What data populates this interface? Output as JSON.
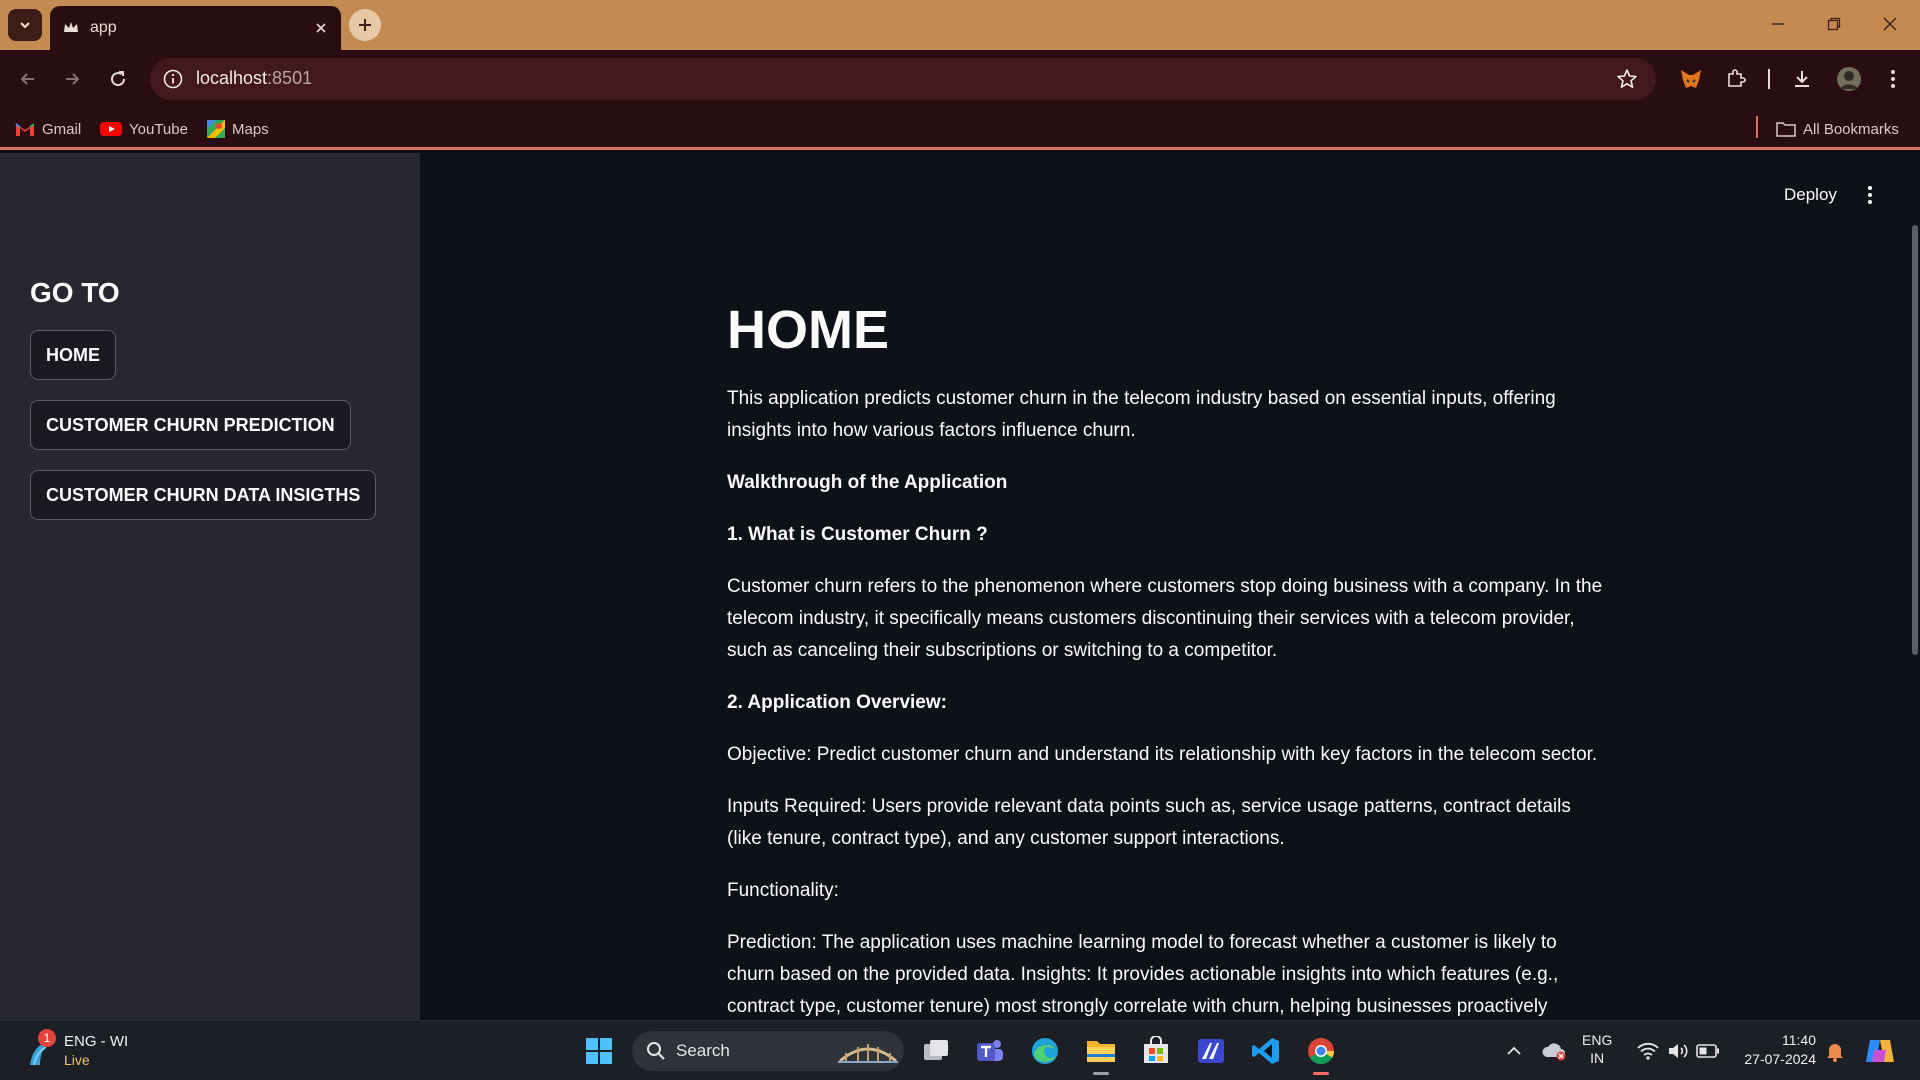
{
  "browser": {
    "tab_title": "app",
    "url_host": "localhost",
    "url_port": ":8501",
    "bookmarks": [
      {
        "label": "Gmail",
        "icon": "gmail-icon"
      },
      {
        "label": "YouTube",
        "icon": "youtube-icon"
      },
      {
        "label": "Maps",
        "icon": "maps-icon"
      }
    ],
    "all_bookmarks_label": "All Bookmarks"
  },
  "sidebar": {
    "heading": "GO TO",
    "buttons": [
      {
        "label": "HOME"
      },
      {
        "label": "CUSTOMER CHURN PREDICTION"
      },
      {
        "label": "CUSTOMER CHURN DATA INSIGTHS"
      }
    ]
  },
  "header": {
    "deploy_label": "Deploy"
  },
  "main": {
    "title": "HOME",
    "intro": "This application predicts customer churn in the telecom industry based on essential inputs, offering insights into how various factors influence churn.",
    "walkthrough_heading": "Walkthrough of the Application",
    "section1_heading": "1. What is Customer Churn ?",
    "section1_text": "Customer churn refers to the phenomenon where customers stop doing business with a company. In the telecom industry, it specifically means customers discontinuing their services with a telecom provider, such as canceling their subscriptions or switching to a competitor.",
    "section2_heading": "2. Application Overview:",
    "objective": "Objective: Predict customer churn and understand its relationship with key factors in the telecom sector.",
    "inputs": "Inputs Required: Users provide relevant data points such as, service usage patterns, contract details (like tenure, contract type), and any customer support interactions.",
    "functionality": "Functionality:",
    "prediction": "Prediction: The application uses machine learning model to forecast whether a customer is likely to churn based on the provided data. Insights: It provides actionable insights into which features (e.g., contract type, customer tenure) most strongly correlate with churn, helping businesses proactively manage"
  },
  "taskbar": {
    "weather_badge": "1",
    "weather_line1": "ENG - WI",
    "weather_line2": "Live",
    "search_label": "Search",
    "lang_line1": "ENG",
    "lang_line2": "IN",
    "time": "11:40",
    "date": "27-07-2024"
  },
  "colors": {
    "tabstrip": "#c58a52",
    "browser_dark": "#2a0d10",
    "sidebar_bg": "#262730",
    "main_bg": "#0e1117",
    "accent_line": "#d9735f"
  }
}
